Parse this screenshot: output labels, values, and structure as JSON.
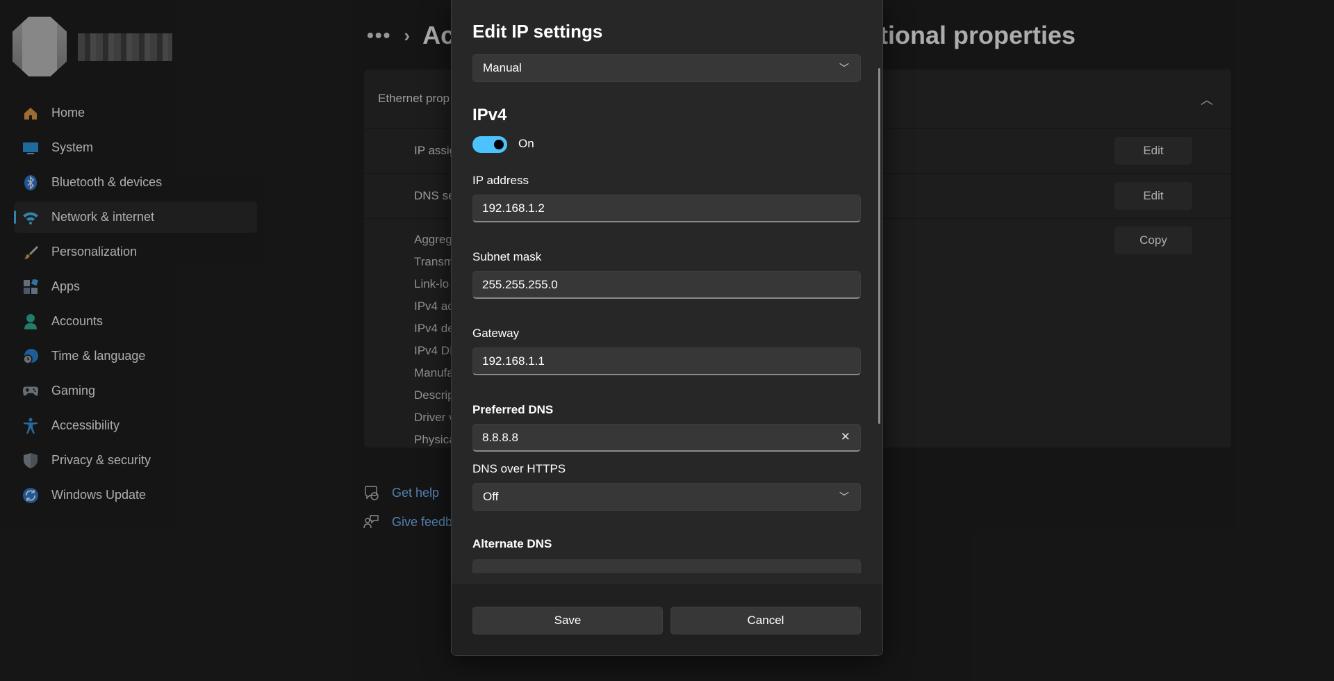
{
  "sidebar": {
    "items": [
      {
        "label": "Home",
        "icon": "home-icon",
        "color": "#e8a04a"
      },
      {
        "label": "System",
        "icon": "system-icon",
        "color": "#4aa8e8"
      },
      {
        "label": "Bluetooth & devices",
        "icon": "bluetooth-icon",
        "color": "#3d8ee6"
      },
      {
        "label": "Network & internet",
        "icon": "wifi-icon",
        "color": "#4cc2ff"
      },
      {
        "label": "Personalization",
        "icon": "brush-icon",
        "color": "#e8a04a"
      },
      {
        "label": "Apps",
        "icon": "apps-icon",
        "color": "#7b8fa8"
      },
      {
        "label": "Accounts",
        "icon": "person-icon",
        "color": "#2eb89a"
      },
      {
        "label": "Time & language",
        "icon": "globe-clock-icon",
        "color": "#3d8ee6"
      },
      {
        "label": "Gaming",
        "icon": "gamepad-icon",
        "color": "#9aa3ad"
      },
      {
        "label": "Accessibility",
        "icon": "accessibility-icon",
        "color": "#3d9be8"
      },
      {
        "label": "Privacy & security",
        "icon": "shield-icon",
        "color": "#8d949c"
      },
      {
        "label": "Windows Update",
        "icon": "update-icon",
        "color": "#3d8ee6"
      }
    ],
    "active_index": 3
  },
  "breadcrumb": {
    "head": "Ac",
    "tail": "tional properties"
  },
  "card": {
    "header": "Ethernet prop",
    "rows": [
      {
        "label": "IP assig",
        "button": "Edit"
      },
      {
        "label": "DNS se",
        "button": "Edit"
      }
    ],
    "copy_button": "Copy",
    "properties": [
      "Aggreg",
      "Transm",
      "Link-lo",
      "IPv4 ac",
      "IPv4 de",
      "IPv4 DI",
      "Manufa",
      "Descrip",
      "Driver v",
      "Physica"
    ]
  },
  "help": {
    "get_help": "Get help",
    "feedback": "Give feedba"
  },
  "dialog": {
    "title": "Edit IP settings",
    "mode": "Manual",
    "section": "IPv4",
    "toggle_label": "On",
    "toggle_on": true,
    "ip_label": "IP address",
    "ip_value": "192.168.1.2",
    "subnet_label": "Subnet mask",
    "subnet_value": "255.255.255.0",
    "gateway_label": "Gateway",
    "gateway_value": "192.168.1.1",
    "pdns_label": "Preferred DNS",
    "pdns_value": "8.8.8.8",
    "doh_label": "DNS over HTTPS",
    "doh_value": "Off",
    "adns_label": "Alternate DNS",
    "save": "Save",
    "cancel": "Cancel"
  },
  "colors": {
    "accent": "#4cc2ff",
    "link": "#79c0ff"
  }
}
